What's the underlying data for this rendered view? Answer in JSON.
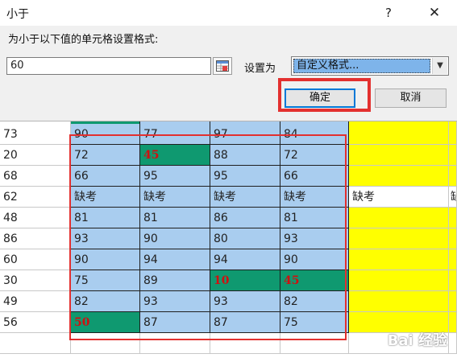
{
  "dialog": {
    "title": "小于",
    "help_label": "?",
    "close_label": "✕",
    "prompt": "为小于以下值的单元格设置格式:",
    "value": "60",
    "set_as_label": "设置为",
    "format_selected": "自定义格式...",
    "ok_label": "确定",
    "cancel_label": "取消"
  },
  "sheet": {
    "top_partial_row": [
      "73",
      "90",
      "77",
      "97",
      "84"
    ],
    "rows": [
      {
        "cells": [
          "73",
          "90",
          "77",
          "97",
          "84",
          "",
          ""
        ]
      },
      {
        "cells": [
          "20",
          "72",
          "45",
          "88",
          "72",
          "",
          ""
        ]
      },
      {
        "cells": [
          "68",
          "66",
          "95",
          "95",
          "66",
          "",
          ""
        ]
      },
      {
        "cells": [
          "62",
          "缺考",
          "缺考",
          "缺考",
          "缺考",
          "缺考",
          "缺"
        ]
      },
      {
        "cells": [
          "48",
          "81",
          "81",
          "86",
          "81",
          "",
          ""
        ]
      },
      {
        "cells": [
          "86",
          "93",
          "90",
          "80",
          "93",
          "",
          ""
        ]
      },
      {
        "cells": [
          "60",
          "90",
          "94",
          "94",
          "90",
          "",
          ""
        ]
      },
      {
        "cells": [
          "30",
          "75",
          "89",
          "10",
          "45",
          "",
          ""
        ]
      },
      {
        "cells": [
          "49",
          "82",
          "93",
          "93",
          "82",
          "",
          ""
        ]
      },
      {
        "cells": [
          "56",
          "50",
          "87",
          "87",
          "75",
          "",
          ""
        ]
      }
    ],
    "highlight_color": "#0f9970",
    "highlight_text_color": "#d01010",
    "selection_color": "#a9cdef",
    "fill_yellow": "#ffff00"
  },
  "watermark": "Bai 经验"
}
